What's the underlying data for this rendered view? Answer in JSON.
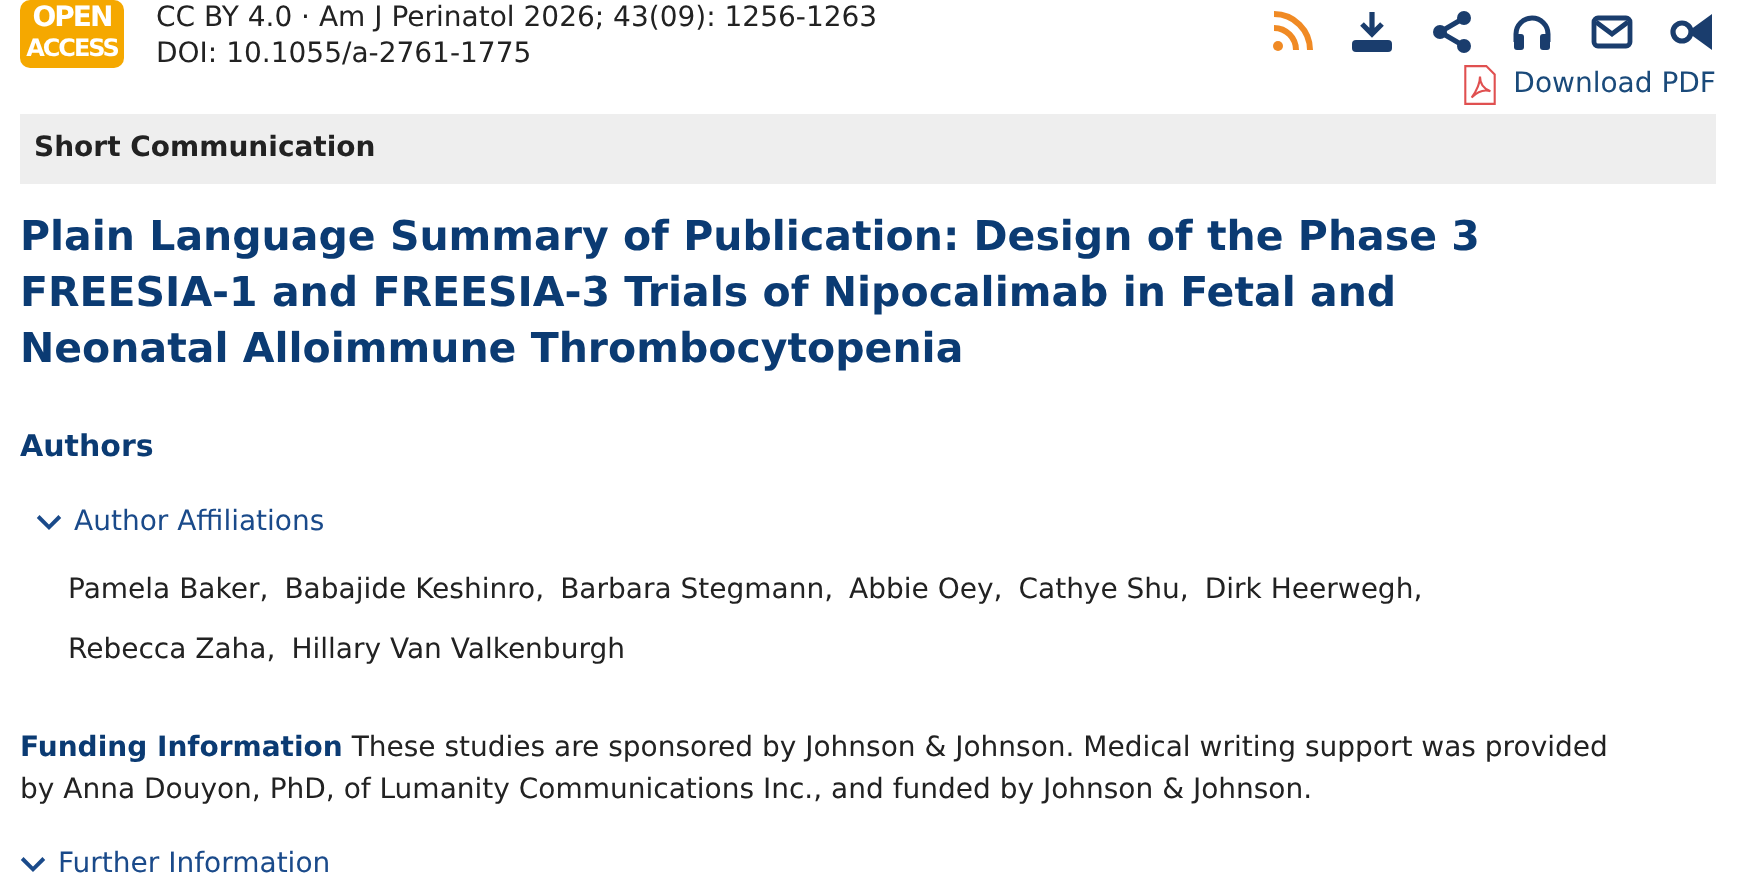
{
  "badge": {
    "lines": [
      "OPEN",
      "ACCESS"
    ]
  },
  "citation": "CC BY 4.0 · Am J Perinatol 2026; 43(09): 1256-1263",
  "doi": "DOI: 10.1055/a-2761-1775",
  "toolbar": [
    {
      "kind": "rss"
    },
    {
      "kind": "download"
    },
    {
      "kind": "share"
    },
    {
      "kind": "headphones"
    },
    {
      "kind": "mail"
    },
    {
      "kind": "horn"
    }
  ],
  "download_pdf": "Download PDF",
  "article_type": "Short Communication",
  "title": "Plain Language Summary of Publication: Design of the Phase 3 FREESIA-1 and FREESIA-3 Trials of Nipocalimab in Fetal and Neonatal Alloimmune Thrombocytopenia",
  "authors_heading": "Authors",
  "affiliations": {
    "label": "Author Affiliations",
    "expanded": false
  },
  "authors": [
    "Pamela Baker,",
    "Babajide Keshinro,",
    "Barbara Stegmann,",
    "Abbie Oey,",
    "Cathye Shu,",
    "Dirk Heerwegh,",
    "Rebecca Zaha,",
    "Hillary Van Valkenburgh"
  ],
  "funding": "**Funding Information** These studies are sponsored by Johnson & Johnson. Medical writing support was provided by Anna Douyon, PhD, of Lumanity Communications Inc., and funded by Johnson & Johnson.",
  "further": {
    "label": "Further Information",
    "expanded": false
  }
}
